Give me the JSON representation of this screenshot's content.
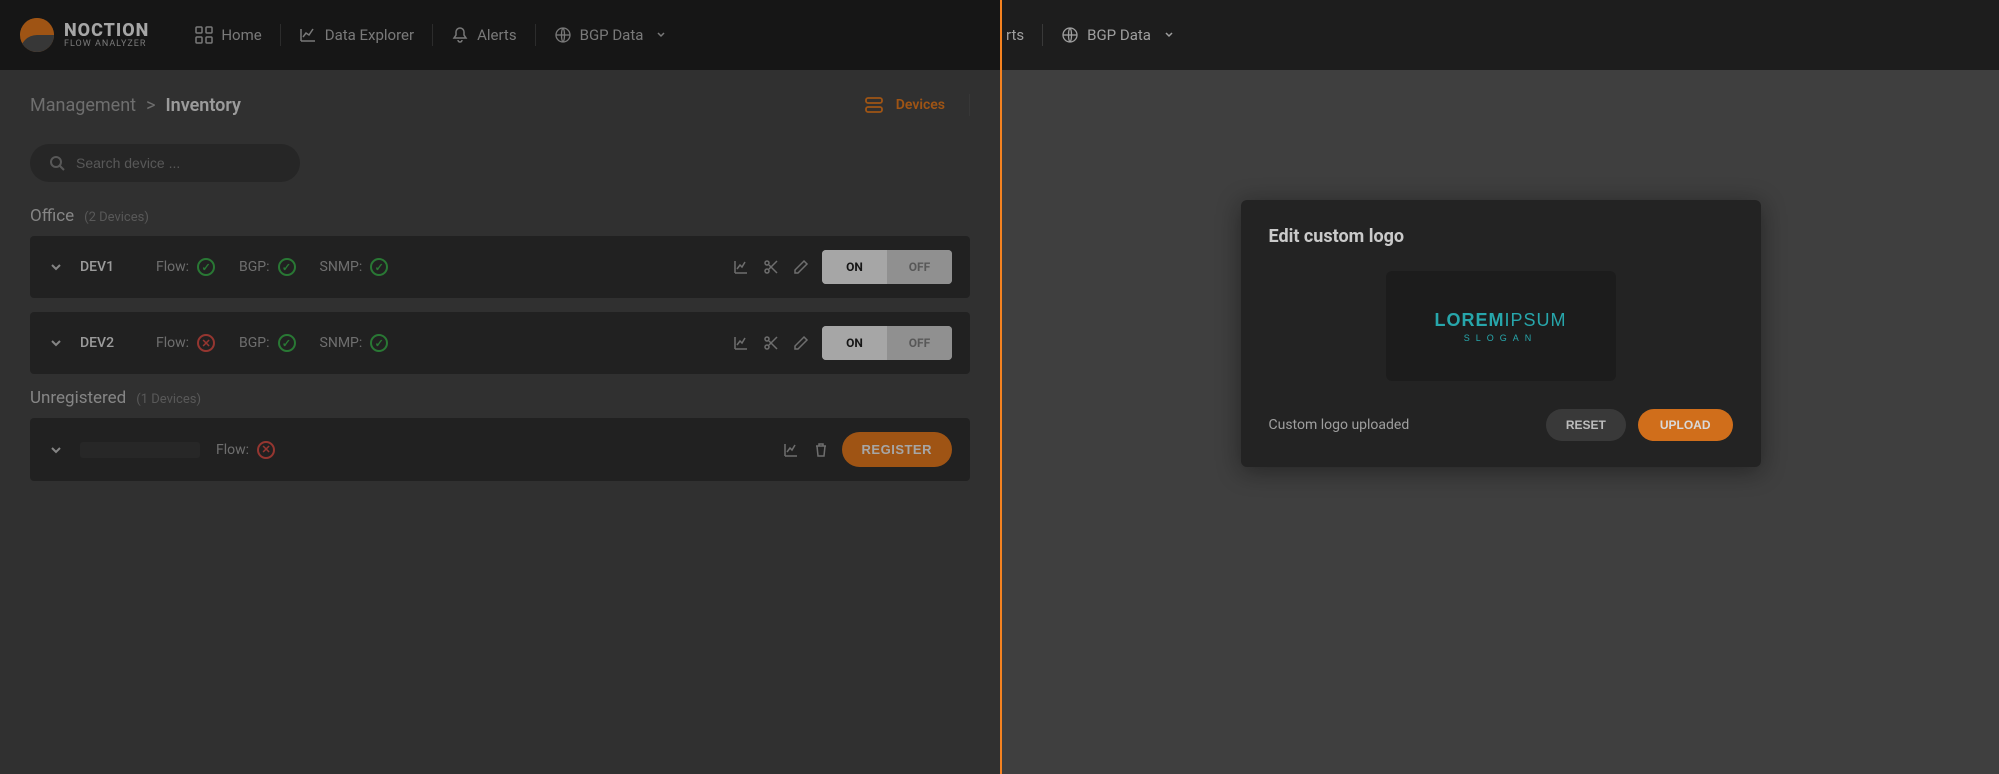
{
  "brand": {
    "name": "NOCTION",
    "sub": "FLOW ANALYZER"
  },
  "nav": {
    "home": "Home",
    "data_explorer": "Data Explorer",
    "alerts": "Alerts",
    "bgp_data": "BGP Data",
    "rts_partial": "rts"
  },
  "breadcrumb": {
    "root": "Management",
    "sep": ">",
    "current": "Inventory"
  },
  "view_tab": {
    "devices": "Devices"
  },
  "search": {
    "placeholder": "Search device ..."
  },
  "groups": [
    {
      "name": "Office",
      "count": "(2 Devices)",
      "devices": [
        {
          "name": "DEV1",
          "flow_label": "Flow:",
          "flow_status": "ok",
          "bgp_label": "BGP:",
          "bgp_status": "ok",
          "snmp_label": "SNMP:",
          "snmp_status": "ok",
          "toggle_on": "ON",
          "toggle_off": "OFF"
        },
        {
          "name": "DEV2",
          "flow_label": "Flow:",
          "flow_status": "bad",
          "bgp_label": "BGP:",
          "bgp_status": "ok",
          "snmp_label": "SNMP:",
          "snmp_status": "ok",
          "toggle_on": "ON",
          "toggle_off": "OFF"
        }
      ]
    },
    {
      "name": "Unregistered",
      "count": "(1 Devices)",
      "devices": [
        {
          "name_redacted": true,
          "flow_label": "Flow:",
          "flow_status": "bad",
          "register_label": "REGISTER"
        }
      ]
    }
  ],
  "modal": {
    "title": "Edit custom logo",
    "preview_line1_bold": "LOREM",
    "preview_line1_thin": "IPSUM",
    "preview_line2": "SLOGAN",
    "status_msg": "Custom logo uploaded",
    "reset": "RESET",
    "upload": "UPLOAD"
  }
}
